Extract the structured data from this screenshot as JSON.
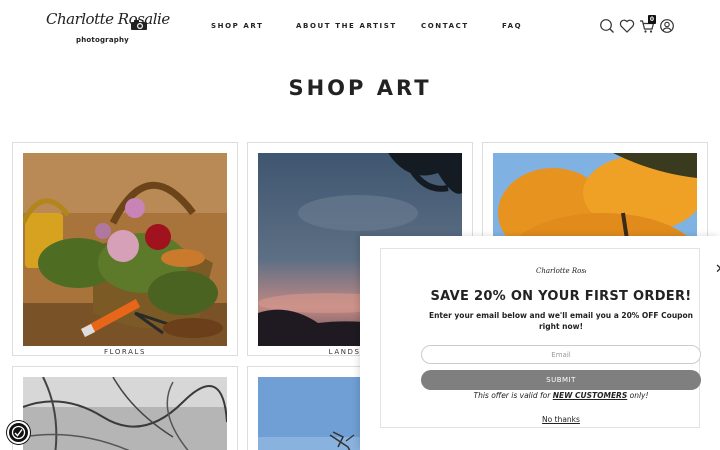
{
  "logo": {
    "script": "Charlotte Rosalie",
    "sub": "photography"
  },
  "nav": [
    {
      "label": "SHOP ART"
    },
    {
      "label": "ABOUT THE ARTIST"
    },
    {
      "label": "CONTACT"
    },
    {
      "label": "FAQ"
    }
  ],
  "header_icons": [
    "search-icon",
    "heart-icon",
    "cart-icon",
    "user-icon"
  ],
  "cart": {
    "count": "0"
  },
  "page": {
    "title": "SHOP ART"
  },
  "products": [
    {
      "caption": "FLORALS",
      "image": "flower-basket-photo"
    },
    {
      "caption": "LANDSCAPES",
      "image": "dusk-sky-photo"
    },
    {
      "caption": "",
      "image": "autumn-tree-photo"
    },
    {
      "caption": "",
      "image": "frosty-branches-photo"
    },
    {
      "caption": "",
      "image": "blue-sky-structure-photo"
    }
  ],
  "popup": {
    "logo": "Charlotte Rosalie photography",
    "heading": "SAVE 20% ON YOUR FIRST ORDER!",
    "text": "Enter your email below and we'll email you a 20% OFF Coupon right now!",
    "email_placeholder": "Email",
    "submit": "SUBMIT",
    "offer_pre": "This offer is valid for ",
    "offer_bold": "NEW CUSTOMERS",
    "offer_post": " only!",
    "no_thanks": "No thanks"
  },
  "colors": {
    "accent": "#7f7f7f",
    "text": "#222222",
    "border": "#dddddd"
  }
}
